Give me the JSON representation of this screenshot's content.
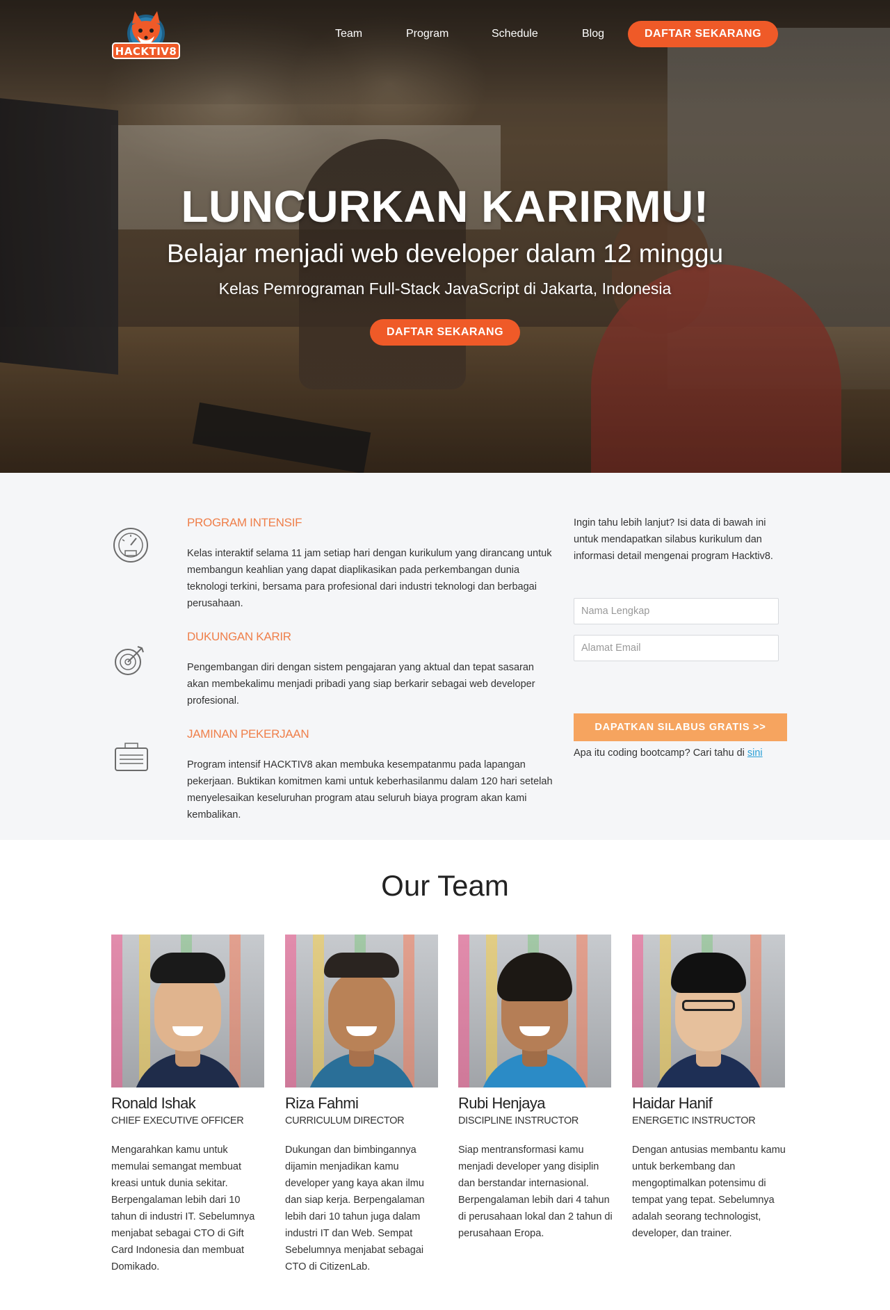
{
  "brand": {
    "logo_text": "HACKTIV8",
    "accent": "#ef5a28",
    "form_button_color": "#f6a45f",
    "feature_title_color": "#ef7f4a"
  },
  "nav": {
    "items": [
      "Team",
      "Program",
      "Schedule",
      "Blog"
    ],
    "cta": "DAFTAR SEKARANG"
  },
  "hero": {
    "title": "LUNCURKAN KARIRMU!",
    "subtitle": "Belajar menjadi web developer dalam 12 minggu",
    "tagline": "Kelas Pemrograman Full-Stack JavaScript di Jakarta, Indonesia",
    "cta": "DAFTAR SEKARANG"
  },
  "features": [
    {
      "icon": "speedometer-icon",
      "title": "PROGRAM INTENSIF",
      "desc": "Kelas interaktif selama 11 jam setiap hari dengan kurikulum yang dirancang untuk membangun keahlian yang dapat diaplikasikan pada perkembangan dunia teknologi terkini, bersama para profesional dari industri teknologi dan berbagai perusahaan."
    },
    {
      "icon": "target-icon",
      "title": "DUKUNGAN KARIR",
      "desc": "Pengembangan diri dengan sistem pengajaran yang aktual dan tepat sasaran akan membekalimu menjadi pribadi yang siap berkarir sebagai web developer profesional."
    },
    {
      "icon": "briefcase-icon",
      "title": "JAMINAN PEKERJAAN",
      "desc": "Program intensif HACKTIV8 akan membuka kesempatanmu pada lapangan pekerjaan. Buktikan komitmen kami untuk keberhasilanmu dalam 120 hari setelah menyelesaikan keseluruhan program atau seluruh biaya program akan kami kembalikan."
    }
  ],
  "signup": {
    "intro": "Ingin tahu lebih lanjut? Isi data di bawah ini untuk mendapatkan silabus kurikulum dan informasi detail mengenai program Hacktiv8.",
    "name_placeholder": "Nama Lengkap",
    "email_placeholder": "Alamat Email",
    "submit": "DAPATKAN SILABUS GRATIS >>",
    "footer_text": "Apa itu coding bootcamp? Cari tahu di ",
    "footer_link": "sini"
  },
  "team": {
    "title": "Our Team",
    "members": [
      {
        "name": "Ronald Ishak",
        "role": "CHIEF EXECUTIVE OFFICER",
        "bio": "Mengarahkan kamu untuk memulai semangat membuat kreasi untuk dunia sekitar. Berpengalaman lebih dari 10 tahun di industri IT. Sebelumnya menjabat sebagai CTO di Gift Card Indonesia dan membuat Domikado."
      },
      {
        "name": "Riza Fahmi",
        "role": "CURRICULUM DIRECTOR",
        "bio": "Dukungan dan bimbingannya dijamin menjadikan kamu developer yang kaya akan ilmu dan siap kerja. Berpengalaman lebih dari 10 tahun juga dalam industri IT dan Web. Sempat Sebelumnya menjabat sebagai CTO di CitizenLab."
      },
      {
        "name": "Rubi Henjaya",
        "role": "DISCIPLINE INSTRUCTOR",
        "bio": "Siap mentransformasi kamu menjadi developer yang disiplin dan berstandar internasional. Berpengalaman lebih dari 4 tahun di perusahaan lokal dan 2 tahun di perusahaan Eropa."
      },
      {
        "name": "Haidar Hanif",
        "role": "ENERGETIC INSTRUCTOR",
        "bio": "Dengan antusias membantu kamu untuk berkembang dan mengoptimalkan potensimu di tempat yang tepat. Sebelumnya adalah seorang technologist, developer, dan trainer."
      }
    ]
  }
}
